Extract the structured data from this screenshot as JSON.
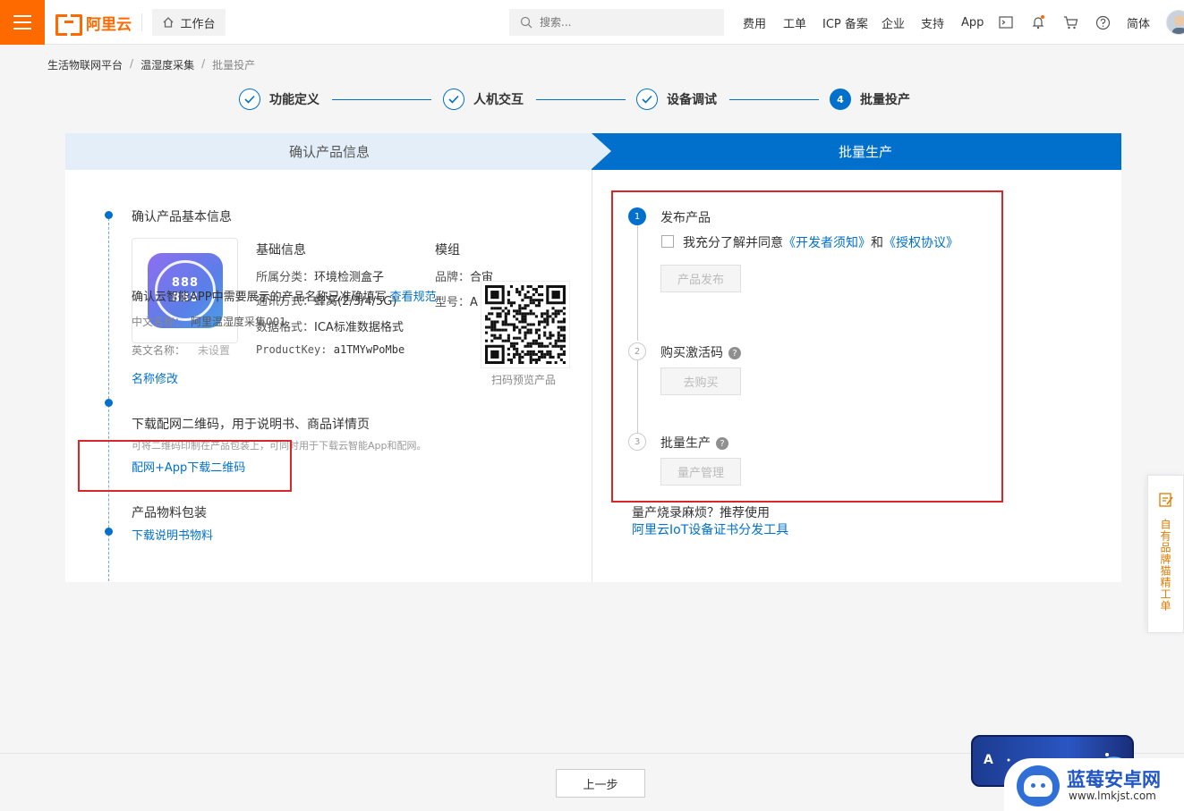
{
  "topbar": {
    "logo_text": "阿里云",
    "workbench_label": "工作台",
    "search_placeholder": "搜索...",
    "nav": [
      "费用",
      "工单",
      "ICP 备案",
      "企业",
      "支持",
      "App"
    ],
    "language": "简体",
    "icons": [
      "terminal-icon",
      "bell-icon",
      "cart-icon",
      "help-icon"
    ],
    "accent_color": "#ff6a00"
  },
  "breadcrumb": [
    "生活物联网平台",
    "温湿度采集",
    "批量投产"
  ],
  "steps": [
    {
      "label": "功能定义",
      "state": "done"
    },
    {
      "label": "人机交互",
      "state": "done"
    },
    {
      "label": "设备调试",
      "state": "done"
    },
    {
      "label": "批量投产",
      "state": "active",
      "number": "4"
    }
  ],
  "tabs": {
    "left": "确认产品信息",
    "right": "批量生产"
  },
  "left": {
    "section1_title": "确认产品基本信息",
    "basic_info_title": "基础信息",
    "category_label": "所属分类：",
    "category_value": "环境检测盒子",
    "comm_label": "通讯方式：",
    "comm_value": "蜂窝(2/3/4/5G)",
    "format_label": "数据格式：",
    "format_value": "ICA标准数据格式",
    "productkey_label": "ProductKey:",
    "productkey_value": "a1TMYwPoMbe",
    "module_title": "模组",
    "brand_label": "品牌：",
    "brand_value": "合宙",
    "model_label": "型号：",
    "model_value": "A",
    "qr_caption": "扫码预览产品",
    "name_note": "确认云智能APP中需要展示的产品名称已准确填写",
    "name_note_link": "查看规范",
    "cn_name_label": "中文名称：",
    "cn_name_value": "阿里温湿度采集001",
    "en_name_label": "英文名称：",
    "en_name_value": "未设置",
    "rename_link": "名称修改",
    "icon_digits": [
      "888",
      "888"
    ],
    "section2_title": "下载配网二维码，用于说明书、商品详情页",
    "section2_desc": "可将二维码印制在产品包装上，可同时用于下载云智能App和配网。",
    "section2_link": "配网+App下载二维码",
    "section3_title": "产品物料包装",
    "section3_link": "下载说明书物料"
  },
  "right": {
    "step1_num": "1",
    "step1_title": "发布产品",
    "agree_text": "我充分了解并同意",
    "agree_link1": "《开发者须知》",
    "agree_and": "和",
    "agree_link2": "《授权协议》",
    "publish_btn": "产品发布",
    "step2_num": "2",
    "step2_title": "购买激活码",
    "buy_btn": "去购买",
    "step3_num": "3",
    "step3_title": "批量生产",
    "manage_btn": "量产管理",
    "tip": "量产烧录麻烦？推荐使用",
    "tip_link": "阿里云IoT设备证书分发工具",
    "help_glyph": "?"
  },
  "footer": {
    "prev_btn": "上一步"
  },
  "side_tab": {
    "label": "自有品牌猫精工单"
  },
  "promo": {
    "text": "A"
  },
  "watermark": {
    "title": "蓝莓安卓网",
    "url": "www.lmkjst.com"
  }
}
